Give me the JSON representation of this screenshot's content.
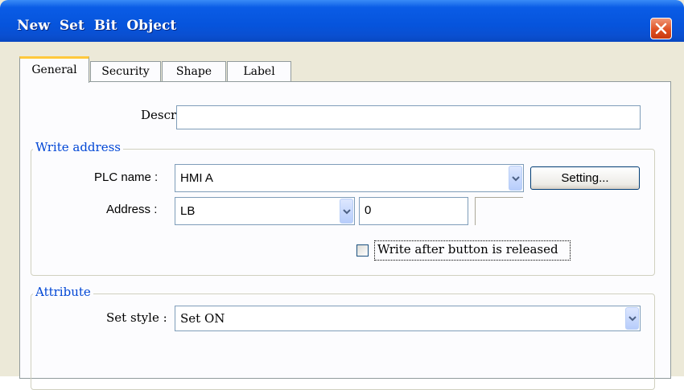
{
  "window": {
    "title": "New  Set Bit Object"
  },
  "tabs": [
    {
      "label": "General"
    },
    {
      "label": "Security"
    },
    {
      "label": "Shape"
    },
    {
      "label": "Label"
    }
  ],
  "general": {
    "description_label": "Description :",
    "description_value": ""
  },
  "write_address": {
    "group_title": "Write address",
    "plc_name_label": "PLC name :",
    "plc_name_value": "HMI A",
    "setting_button": "Setting...",
    "address_label": "Address :",
    "address_device": "LB",
    "address_value": "0",
    "write_after_release_label": "Write after button is released",
    "write_after_release_checked": false
  },
  "attribute": {
    "group_title": "Attribute",
    "set_style_label": "Set style :",
    "set_style_value": "Set ON"
  },
  "colors": {
    "titlebar": "#0654dc",
    "close_button": "#dd4c1e",
    "group_title": "#0046d5",
    "tab_highlight": "#ffc83c"
  }
}
